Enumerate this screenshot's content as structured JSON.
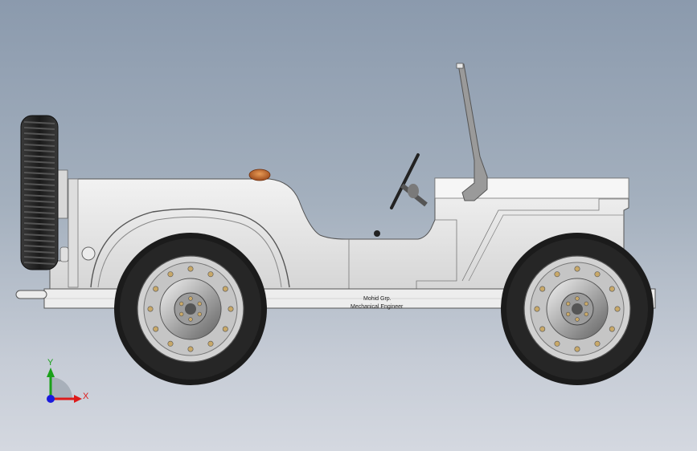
{
  "decal": {
    "line1": "Mohid Grp.",
    "line2": "Mechanical Engineer"
  },
  "triad": {
    "y_label": "Y",
    "x_label": "X",
    "y_color": "#1aa01a",
    "x_color": "#dd1a1a",
    "z_color": "#1a1add"
  },
  "colors": {
    "body": "#e9e9e9",
    "body_shadow": "#b9b9b9",
    "tire": "#1b1b1b",
    "rim": "#c9c9c9",
    "lug": "#c8a868",
    "lamp": "#c8682a"
  }
}
